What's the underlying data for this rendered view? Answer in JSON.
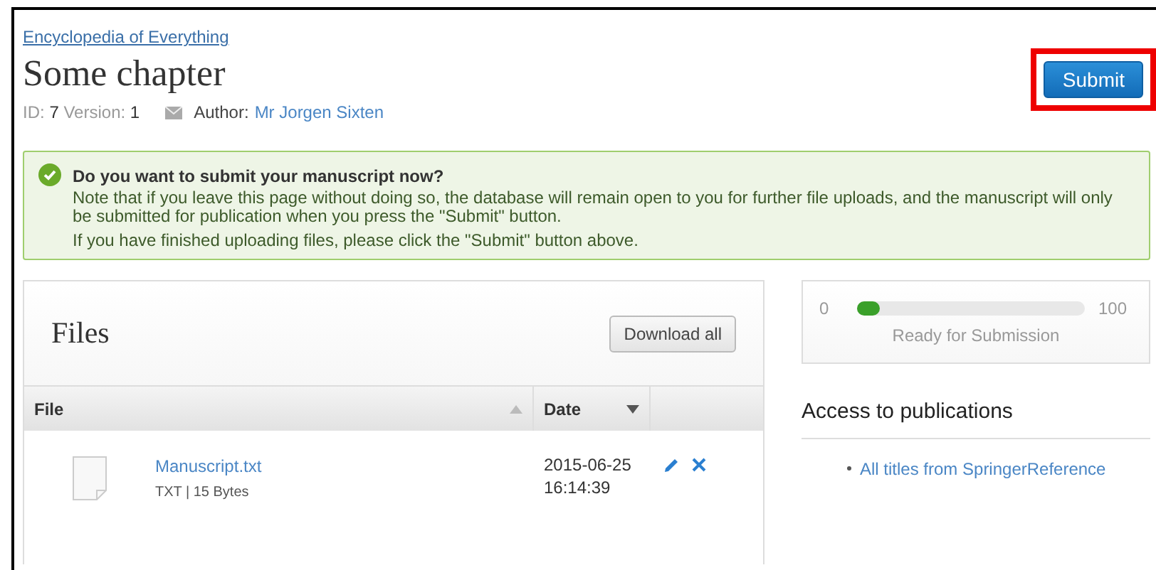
{
  "breadcrumb": "Encyclopedia of Everything",
  "title": "Some chapter",
  "meta": {
    "id_label": "ID:",
    "id": "7",
    "version_label": "Version:",
    "version": "1",
    "author_label": "Author:",
    "author": "Mr Jorgen Sixten"
  },
  "submit_button": {
    "label": "Submit",
    "highlighted": true
  },
  "notice": {
    "heading": "Do you want to submit your manuscript now?",
    "lines": [
      "Note that if you leave this page without doing so, the database will remain open to you for further file uploads, and the manuscript will only be submitted for publication when you press the \"Submit\" button.",
      "If you have finished uploading files, please click the \"Submit\" button above."
    ]
  },
  "files": {
    "title": "Files",
    "download_button": "Download all",
    "columns": [
      {
        "label": "File",
        "ascending": true,
        "selected": false
      },
      {
        "label": "Date",
        "ascending": false,
        "selected": true
      }
    ],
    "rows": [
      {
        "name": "Manuscript.txt",
        "info": "TXT | 15 Bytes",
        "date": "2015-06-25",
        "time": "16:14:39"
      }
    ]
  },
  "progress": {
    "min": "0",
    "max": "100",
    "level": 0.1,
    "caption": "Ready for Submission"
  },
  "access": {
    "title": "Access to publications",
    "links": [
      "All titles from SpringerReference"
    ]
  }
}
